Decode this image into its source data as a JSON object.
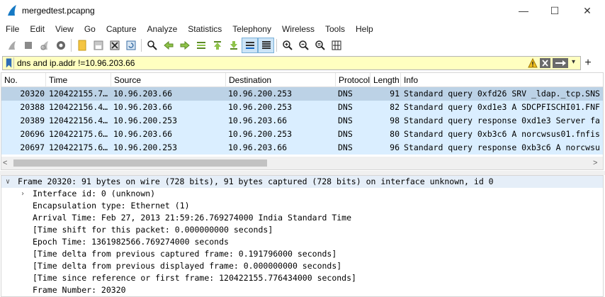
{
  "window": {
    "title": "mergedtest.pcapng",
    "minimize_glyph": "—",
    "maximize_glyph": "☐",
    "close_glyph": "✕"
  },
  "menu": [
    "File",
    "Edit",
    "View",
    "Go",
    "Capture",
    "Analyze",
    "Statistics",
    "Telephony",
    "Wireless",
    "Tools",
    "Help"
  ],
  "toolbar": {
    "icons": [
      "shark-fin-start-icon",
      "stop-capture-icon",
      "restart-capture-icon",
      "capture-options-icon",
      "open-file-icon",
      "save-file-icon",
      "close-file-icon",
      "reload-file-icon",
      "find-packet-icon",
      "go-back-icon",
      "go-forward-icon",
      "go-to-packet-icon",
      "go-first-icon",
      "go-last-icon",
      "auto-scroll-icon",
      "colorize-icon",
      "zoom-in-icon",
      "zoom-out-icon",
      "normal-size-icon",
      "resize-columns-icon"
    ]
  },
  "filter": {
    "value": "dns and ip.addr !=10.96.203.66",
    "dropdown_glyph": "▾",
    "add_glyph": "+"
  },
  "packet_list": {
    "columns": [
      "No.",
      "Time",
      "Source",
      "Destination",
      "Protocol",
      "Length",
      "Info"
    ],
    "rows": [
      {
        "no": "20320",
        "time": "120422155.7…",
        "source": "10.96.203.66",
        "destination": "10.96.200.253",
        "protocol": "DNS",
        "length": "91",
        "info": "Standard query 0xfd26 SRV _ldap._tcp.SNS"
      },
      {
        "no": "20388",
        "time": "120422156.4…",
        "source": "10.96.203.66",
        "destination": "10.96.200.253",
        "protocol": "DNS",
        "length": "82",
        "info": "Standard query 0xd1e3 A SDCPFISCHI01.FNF"
      },
      {
        "no": "20389",
        "time": "120422156.4…",
        "source": "10.96.200.253",
        "destination": "10.96.203.66",
        "protocol": "DNS",
        "length": "98",
        "info": "Standard query response 0xd1e3 Server fa"
      },
      {
        "no": "20696",
        "time": "120422175.6…",
        "source": "10.96.203.66",
        "destination": "10.96.200.253",
        "protocol": "DNS",
        "length": "80",
        "info": "Standard query 0xb3c6 A norcwsus01.fnfis"
      },
      {
        "no": "20697",
        "time": "120422175.6…",
        "source": "10.96.200.253",
        "destination": "10.96.203.66",
        "protocol": "DNS",
        "length": "96",
        "info": "Standard query response 0xb3c6 A norcwsu"
      }
    ],
    "scroll_left_glyph": "<",
    "scroll_right_glyph": ">"
  },
  "details": {
    "rows": [
      {
        "arrow": "∨",
        "text": "Frame 20320: 91 bytes on wire (728 bits), 91 bytes captured (728 bits) on interface unknown, id 0"
      },
      {
        "arrow": "›",
        "text": "Interface id: 0 (unknown)"
      },
      {
        "arrow": "",
        "text": "Encapsulation type: Ethernet (1)"
      },
      {
        "arrow": "",
        "text": "Arrival Time: Feb 27, 2013 21:59:26.769274000 India Standard Time"
      },
      {
        "arrow": "",
        "text": "[Time shift for this packet: 0.000000000 seconds]"
      },
      {
        "arrow": "",
        "text": "Epoch Time: 1361982566.769274000 seconds"
      },
      {
        "arrow": "",
        "text": "[Time delta from previous captured frame: 0.191796000 seconds]"
      },
      {
        "arrow": "",
        "text": "[Time delta from previous displayed frame: 0.000000000 seconds]"
      },
      {
        "arrow": "",
        "text": "[Time since reference or first frame: 120422155.776434000 seconds]"
      },
      {
        "arrow": "",
        "text": "Frame Number: 20320"
      }
    ]
  },
  "colors": {
    "row_bg": "#daeeff",
    "selected_row_bg": "#bcd2e6",
    "filter_bg": "#ffffc0"
  }
}
